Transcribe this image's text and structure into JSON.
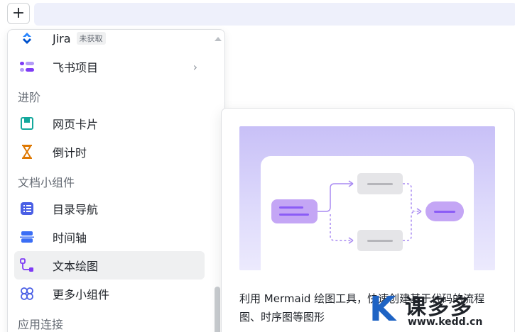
{
  "toolbar": {
    "add_glyph": "+"
  },
  "menu": {
    "items_top": [
      {
        "label": "Jira",
        "badge": "未获取",
        "icon": "jira-icon"
      },
      {
        "label": "飞书项目",
        "icon": "project-icon",
        "has_submenu": true
      }
    ],
    "section_advanced": "进阶",
    "advanced_items": [
      {
        "label": "网页卡片",
        "icon": "web-card-icon"
      },
      {
        "label": "倒计时",
        "icon": "hourglass-icon"
      }
    ],
    "section_widgets": "文档小组件",
    "widget_items": [
      {
        "label": "目录导航",
        "icon": "toc-icon"
      },
      {
        "label": "时间轴",
        "icon": "timeline-icon"
      },
      {
        "label": "文本绘图",
        "icon": "diagram-icon",
        "active": true
      },
      {
        "label": "更多小组件",
        "icon": "widgets-icon"
      }
    ],
    "section_connect": "应用连接",
    "submenu_chevron": "›"
  },
  "preview": {
    "description": "利用 Mermaid 绘图工具，快速创建基于代码的流程图、时序图等图形"
  },
  "watermark": {
    "brand": "课多多",
    "url": "www.kedd.cn",
    "logo_letter": "K"
  },
  "colors": {
    "accent": "#3370ff",
    "purple": "#7f3bf5",
    "teal": "#2ea121",
    "orange": "#de7802"
  }
}
